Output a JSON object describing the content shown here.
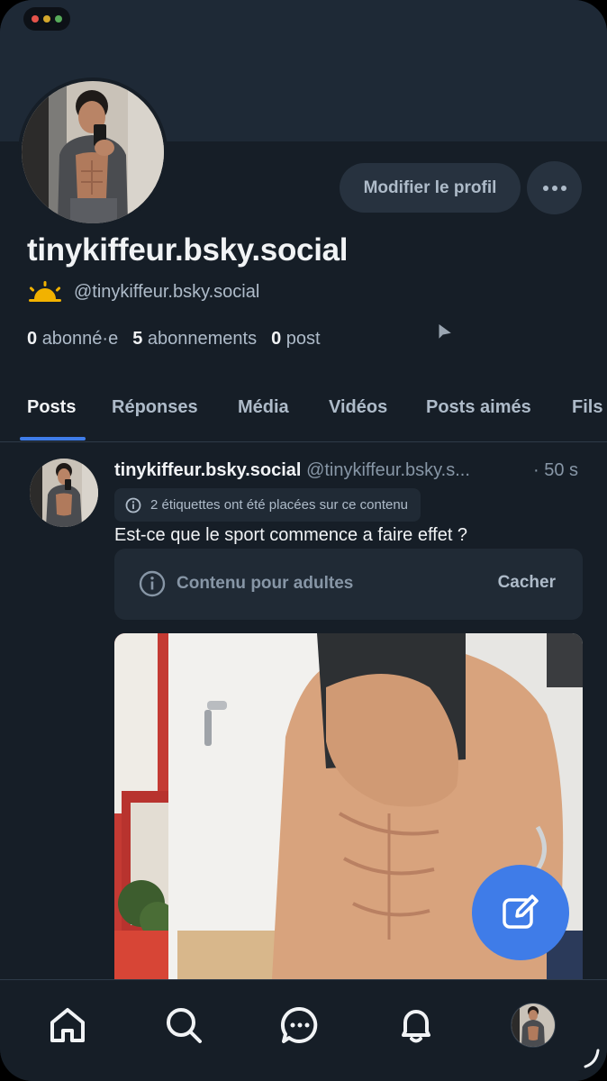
{
  "window": {
    "dots": [
      "#e5534b",
      "#d4a72c",
      "#57ab5a"
    ]
  },
  "profile": {
    "display_name": "tinykiffeur.bsky.social",
    "handle": "@tinykiffeur.bsky.social",
    "handle_icon": "sun-icon",
    "edit_button": "Modifier le profil",
    "more_button_icon": "more-horizontal-icon",
    "stats": {
      "followers_count": "0",
      "followers_label": "abonné·e",
      "following_count": "5",
      "following_label": "abonnements",
      "posts_count": "0",
      "posts_label": "post"
    }
  },
  "tabs": [
    {
      "label": "Posts",
      "active": true
    },
    {
      "label": "Réponses",
      "active": false
    },
    {
      "label": "Média",
      "active": false
    },
    {
      "label": "Vidéos",
      "active": false
    },
    {
      "label": "Posts aimés",
      "active": false
    },
    {
      "label": "Fils",
      "active": false
    }
  ],
  "post": {
    "author_name": "tinykiffeur.bsky.social",
    "author_handle": "@tinykiffeur.bsky.s...",
    "time": "· 50 s",
    "labels_notice": "2 étiquettes ont été placées sur ce contenu",
    "text": "Est-ce que le sport commence a faire effet ?",
    "content_warning": "Contenu pour adultes",
    "hide_button": "Cacher"
  },
  "fab": {
    "icon": "compose-icon"
  },
  "bottom_nav": [
    {
      "name": "home",
      "icon": "home-icon"
    },
    {
      "name": "search",
      "icon": "search-icon"
    },
    {
      "name": "messages",
      "icon": "chat-icon"
    },
    {
      "name": "notifications",
      "icon": "bell-icon"
    },
    {
      "name": "profile",
      "icon": "avatar"
    }
  ],
  "colors": {
    "background": "#161e27",
    "banner": "#1e2936",
    "accent": "#3f7ce8",
    "button_bg": "#27323f",
    "muted_text": "#aebbc9"
  }
}
